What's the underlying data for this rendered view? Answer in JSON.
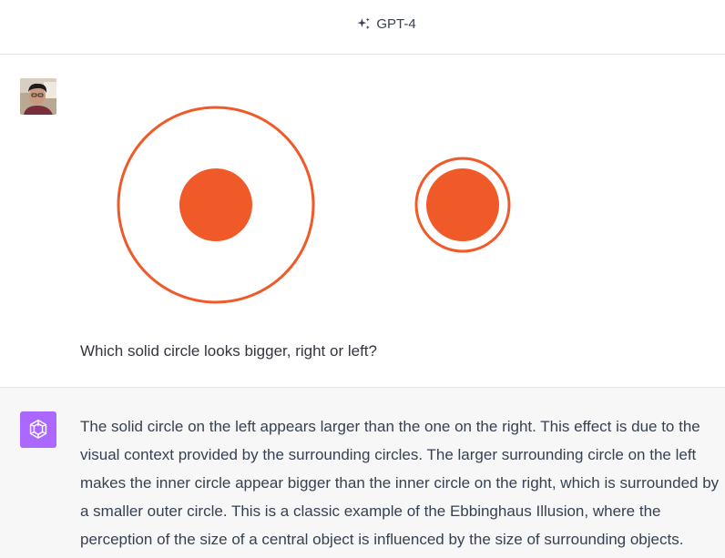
{
  "header": {
    "model_name": "GPT-4",
    "model_icon": "sparkle-icon"
  },
  "user_message": {
    "avatar": "user-avatar-photo",
    "attachment": {
      "description_icon": "ebbinghaus-illusion-image",
      "circle_color": "#f05a28"
    },
    "text": "Which solid circle looks bigger, right or left?"
  },
  "assistant_message": {
    "avatar": "openai-logo-icon",
    "avatar_color": "#ab68ff",
    "text": "The solid circle on the left appears larger than the one on the right. This effect is due to the visual context provided by the surrounding circles. The larger surrounding circle on the left makes the inner circle appear bigger than the inner circle on the right, which is surrounded by a smaller outer circle. This is a classic example of the Ebbinghaus Illusion, where the perception of the size of a central object is influenced by the size of surrounding objects."
  }
}
